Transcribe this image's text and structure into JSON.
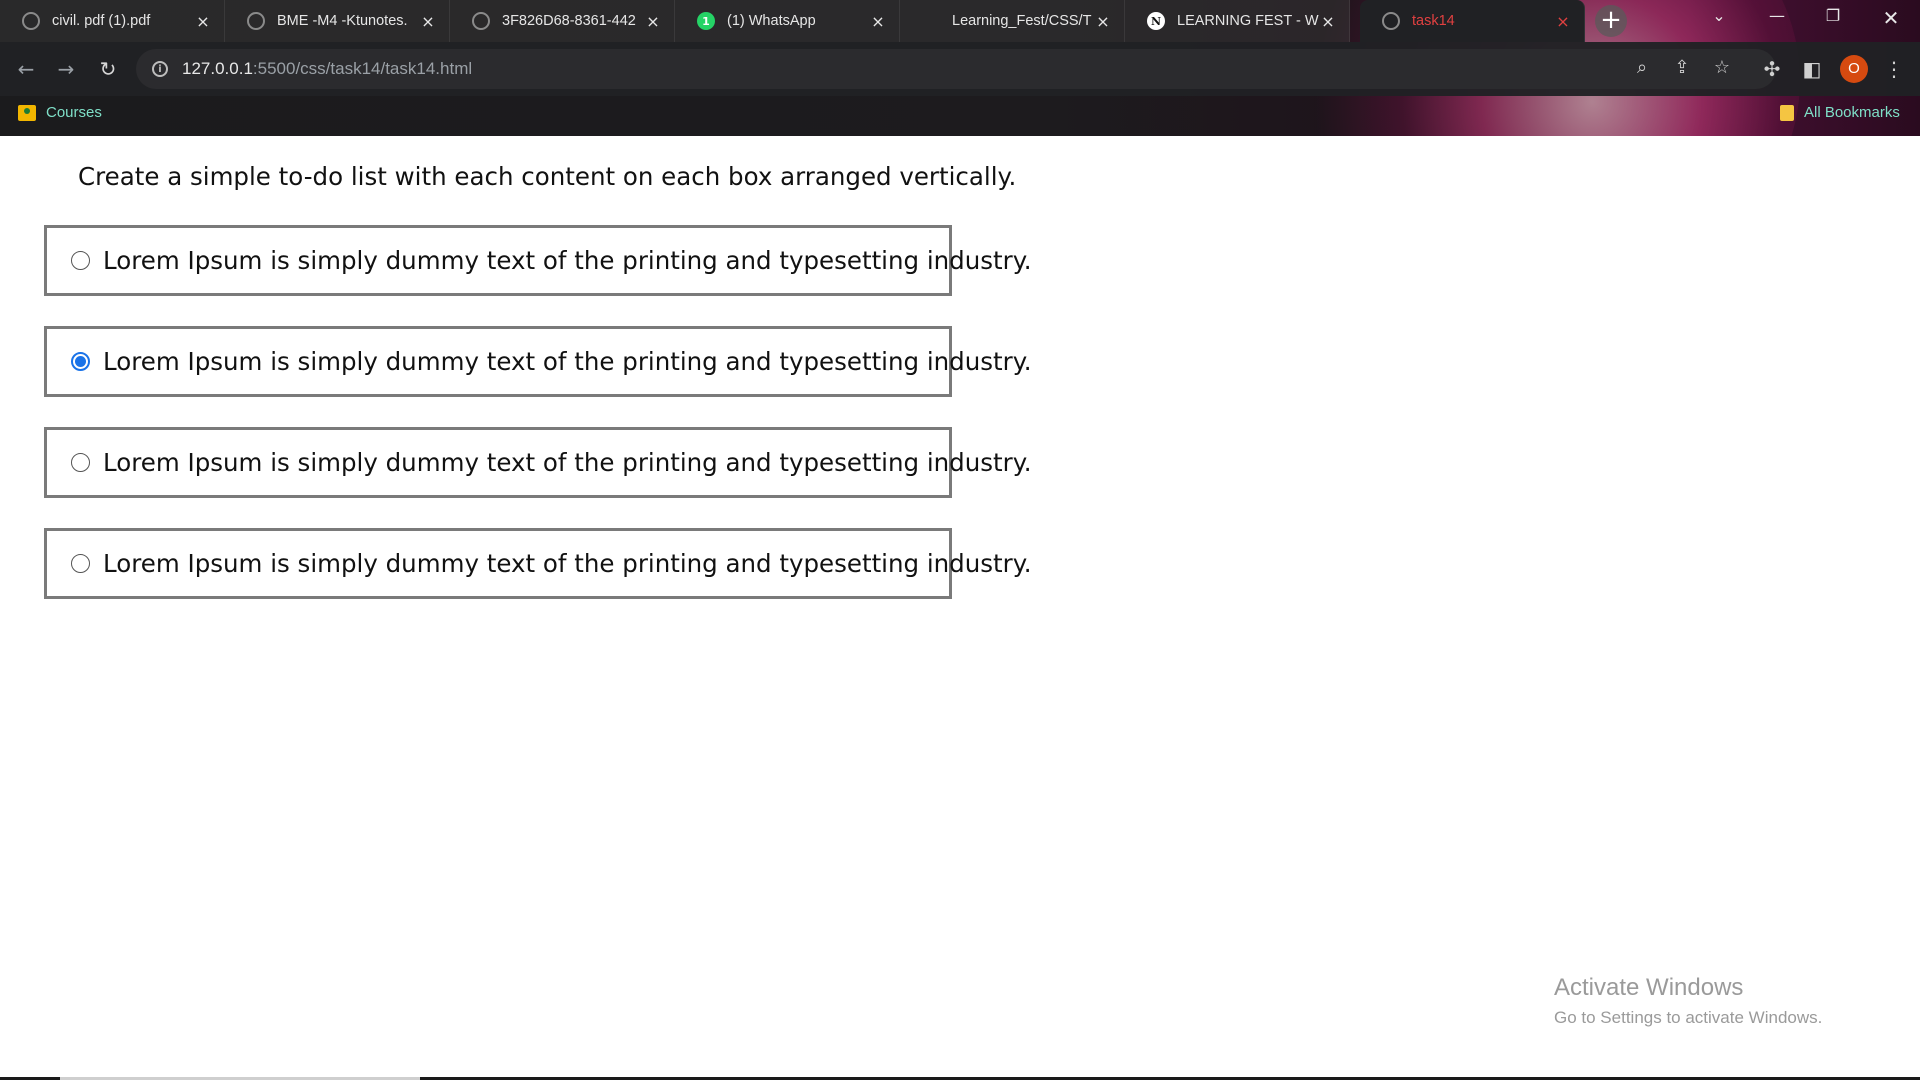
{
  "browser": {
    "tabs": [
      {
        "title": "civil. pdf (1).pdf",
        "icon": "globe-icon",
        "active": false
      },
      {
        "title": "BME -M4 -Ktunotes.",
        "icon": "globe-icon",
        "active": false
      },
      {
        "title": "3F826D68-8361-442",
        "icon": "globe-icon",
        "active": false
      },
      {
        "title": "(1) WhatsApp",
        "icon": "whatsapp-icon",
        "active": false
      },
      {
        "title": "Learning_Fest/CSS/T",
        "icon": "github-icon",
        "active": false
      },
      {
        "title": "LEARNING FEST - W",
        "icon": "notion-icon",
        "active": false
      },
      {
        "title": "task14",
        "icon": "globe-icon",
        "active": true
      }
    ],
    "whatsapp_badge": "1",
    "notion_glyph": "N",
    "close_glyph": "×",
    "new_tab_glyph": "+",
    "url_host": "127.0.0.1",
    "url_path": ":5500/css/task14/task14.html",
    "avatar_letter": "O",
    "bookmarks": {
      "courses": "Courses",
      "all_bookmarks": "All Bookmarks"
    },
    "colors": {
      "active_tab_text": "#e04040",
      "bookmark_text": "#7fe0c8",
      "avatar_bg": "#d64a10"
    }
  },
  "page": {
    "heading": "Create a simple to-do list with each content on each box arranged vertically.",
    "todos": [
      {
        "text": "Lorem Ipsum is simply dummy text of the printing and typesetting industry.",
        "checked": false
      },
      {
        "text": "Lorem Ipsum is simply dummy text of the printing and typesetting industry.",
        "checked": true
      },
      {
        "text": "Lorem Ipsum is simply dummy text of the printing and typesetting industry.",
        "checked": false
      },
      {
        "text": "Lorem Ipsum is simply dummy text of the printing and typesetting industry.",
        "checked": false
      }
    ],
    "colors": {
      "radio_checked": "#1a73e8",
      "box_border": "#7a7a7a"
    }
  },
  "watermark": {
    "title": "Activate Windows",
    "subtitle": "Go to Settings to activate Windows."
  }
}
